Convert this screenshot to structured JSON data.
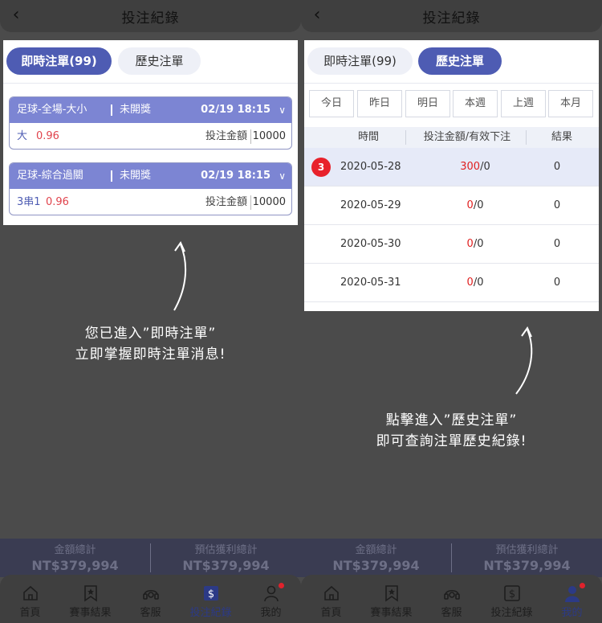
{
  "header": {
    "title": "投注紀錄"
  },
  "left": {
    "tabs": {
      "live_label": "即時注單(99)",
      "history_label": "歷史注單"
    },
    "bets": [
      {
        "game": "足球-全場-大小",
        "status": "未開獎",
        "time": "02/19 18:15",
        "pick": "大",
        "odds": "0.96",
        "amount_label": "投注金額",
        "amount": "10000"
      },
      {
        "game": "足球-綜合過關",
        "status": "未開獎",
        "time": "02/19 18:15",
        "pick": "3串1",
        "odds": "0.96",
        "amount_label": "投注金額",
        "amount": "10000"
      }
    ],
    "annotation": {
      "line1": "您已進入”即時注單”",
      "line2": "立即掌握即時注單消息!"
    }
  },
  "right": {
    "tabs": {
      "live_label": "即時注單(99)",
      "history_label": "歷史注單"
    },
    "date_filters": [
      "今日",
      "昨日",
      "明日",
      "本週",
      "上週",
      "本月"
    ],
    "table": {
      "headers": [
        "時間",
        "投注金額/有效下注",
        "結果"
      ],
      "rows": [
        {
          "badge": "3",
          "date": "2020-05-28",
          "bet": "300",
          "valid": "/0",
          "result": "0"
        },
        {
          "badge": "",
          "date": "2020-05-29",
          "bet": "0",
          "valid": "/0",
          "result": "0"
        },
        {
          "badge": "",
          "date": "2020-05-30",
          "bet": "0",
          "valid": "/0",
          "result": "0"
        },
        {
          "badge": "",
          "date": "2020-05-31",
          "bet": "0",
          "valid": "/0",
          "result": "0"
        }
      ]
    },
    "annotation": {
      "line1": "點擊進入”歷史注單”",
      "line2": "即可查詢注單歷史紀錄!"
    }
  },
  "summary": {
    "total_label": "金額總計",
    "total_value": "NT$379,994",
    "profit_label": "預估獲利總計",
    "profit_value": "NT$379,994"
  },
  "tabbar": {
    "home": "首頁",
    "results": "賽事結果",
    "service": "客服",
    "records": "投注紀錄",
    "mine": "我的"
  },
  "colors": {
    "accent": "#4e5cb3",
    "bet_header": "#7c85d3",
    "odds_red": "#e0434c",
    "badge_red": "#e8212b"
  }
}
